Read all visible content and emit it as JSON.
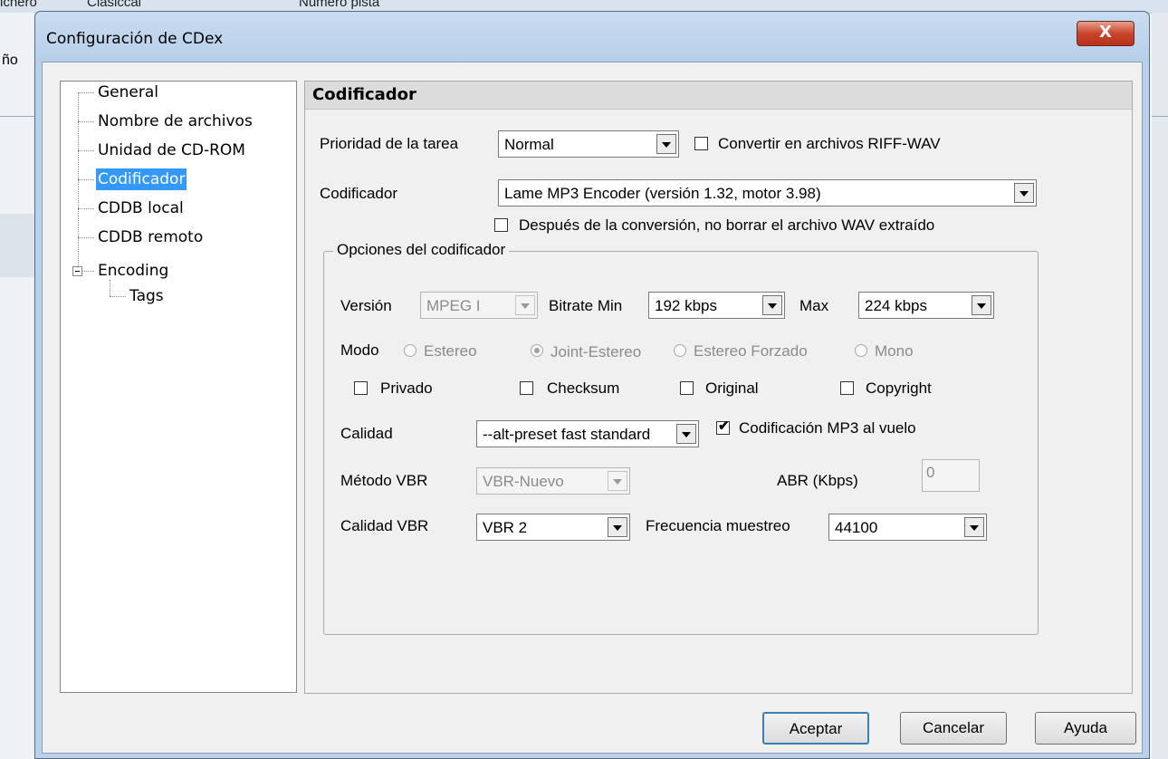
{
  "background": {
    "left_text": "ño",
    "top_texts": [
      "ichero",
      "Clasiccal",
      "Numero pista"
    ]
  },
  "window": {
    "title": "Configuración de CDex",
    "close_glyph": "X"
  },
  "tree": {
    "items": [
      {
        "label": "General"
      },
      {
        "label": "Nombre de archivos"
      },
      {
        "label": "Unidad de CD-ROM"
      },
      {
        "label": "Codificador",
        "selected": true
      },
      {
        "label": "CDDB local"
      },
      {
        "label": "CDDB remoto"
      },
      {
        "label": "Encoding",
        "expanded": true
      },
      {
        "label": "Tags"
      }
    ]
  },
  "panel": {
    "title": "Codificador",
    "priority_label": "Prioridad de la tarea",
    "priority_value": "Normal",
    "riff_wav_label": "Convertir en archivos RIFF-WAV",
    "riff_wav_checked": false,
    "encoder_label": "Codificador",
    "encoder_value": "Lame MP3 Encoder (versión 1.32, motor 3.98)",
    "keep_wav_label": "Después de la conversión, no borrar el archivo WAV extraído",
    "keep_wav_checked": false,
    "options_group": {
      "title": "Opciones del codificador",
      "version_label": "Versión",
      "version_value": "MPEG I",
      "bitrate_min_label": "Bitrate Min",
      "bitrate_min_value": "192 kbps",
      "max_label": "Max",
      "max_value": "224 kbps",
      "mode_label": "Modo",
      "modes": [
        {
          "label": "Estereo",
          "selected": false
        },
        {
          "label": "Joint-Estereo",
          "selected": true
        },
        {
          "label": "Estereo Forzado",
          "selected": false
        },
        {
          "label": "Mono",
          "selected": false
        }
      ],
      "flags": [
        {
          "label": "Privado",
          "checked": false
        },
        {
          "label": "Checksum",
          "checked": false
        },
        {
          "label": "Original",
          "checked": false
        },
        {
          "label": "Copyright",
          "checked": false
        }
      ],
      "quality_label": "Calidad",
      "quality_value": "--alt-preset fast standard",
      "onthefly_label": "Codificación MP3 al vuelo",
      "onthefly_checked": true,
      "vbr_method_label": "Método VBR",
      "vbr_method_value": "VBR-Nuevo",
      "abr_label": "ABR (Kbps)",
      "abr_value": "0",
      "vbr_quality_label": "Calidad VBR",
      "vbr_quality_value": "VBR 2",
      "sample_rate_label": "Frecuencia muestreo",
      "sample_rate_value": "44100"
    }
  },
  "buttons": {
    "ok": "Aceptar",
    "cancel": "Cancelar",
    "help": "Ayuda"
  },
  "check_glyph": "✔"
}
